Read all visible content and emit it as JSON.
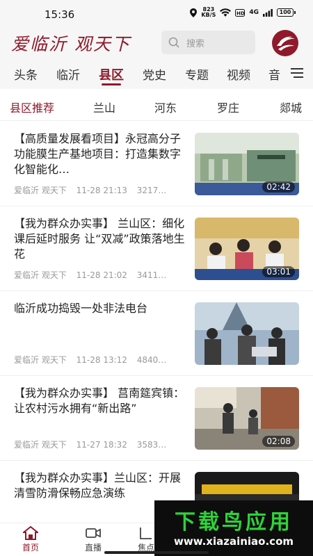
{
  "status_bar": {
    "time": "15:36",
    "net_speed_top": "823",
    "net_speed_bottom": "KB/S",
    "network": "4G",
    "battery": "100"
  },
  "header": {
    "brand": "爱临沂 观天下",
    "search_placeholder": "搜索",
    "logo_icon": "app-logo-icon"
  },
  "channels": [
    "头条",
    "临沂",
    "县区",
    "党史",
    "专题",
    "视频",
    "音"
  ],
  "active_channel": "县区",
  "sub_channels": [
    "县区推荐",
    "兰山",
    "河东",
    "罗庄",
    "郯城"
  ],
  "active_sub_channel": "县区推荐",
  "news": [
    {
      "title": "【高质量发展看项目】永冠高分子功能膜生产基地项目：打造集数字化智能化…",
      "source": "爱临沂 观天下",
      "time": "11-28 21:13",
      "views": "3217…",
      "duration": "02:42"
    },
    {
      "title": "【我为群众办实事】 兰山区：细化课后延时服务 让“双减”政策落地生花",
      "source": "爱临沂 观天下",
      "time": "11-28 21:02",
      "views": "3411…",
      "duration": "03:01"
    },
    {
      "title": "临沂成功捣毁一处非法电台",
      "source": "爱临沂 观天下",
      "time": "11-28 13:12",
      "views": "4840…",
      "duration": ""
    },
    {
      "title": "【我为群众办实事】 莒南筵宾镇：让农村污水拥有“新出路”",
      "source": "爱临沂 观天下",
      "time": "11-27 18:32",
      "views": "3583…",
      "duration": "02:08"
    },
    {
      "title": "【我为群众办实事】兰山区：开展清雪防滑保畅应急演练",
      "source": "",
      "time": "",
      "views": "",
      "duration": ""
    }
  ],
  "tab_bar": [
    {
      "label": "首页",
      "icon": "home-icon"
    },
    {
      "label": "直播",
      "icon": "video-camera-icon"
    },
    {
      "label": "焦点",
      "icon": "focus-icon"
    }
  ],
  "watermark": {
    "text": "下载鸟应用",
    "url": "www.xiazainiao.com"
  },
  "colors": {
    "accent": "#8e1a2b",
    "watermark_green": "#2fd23a"
  }
}
